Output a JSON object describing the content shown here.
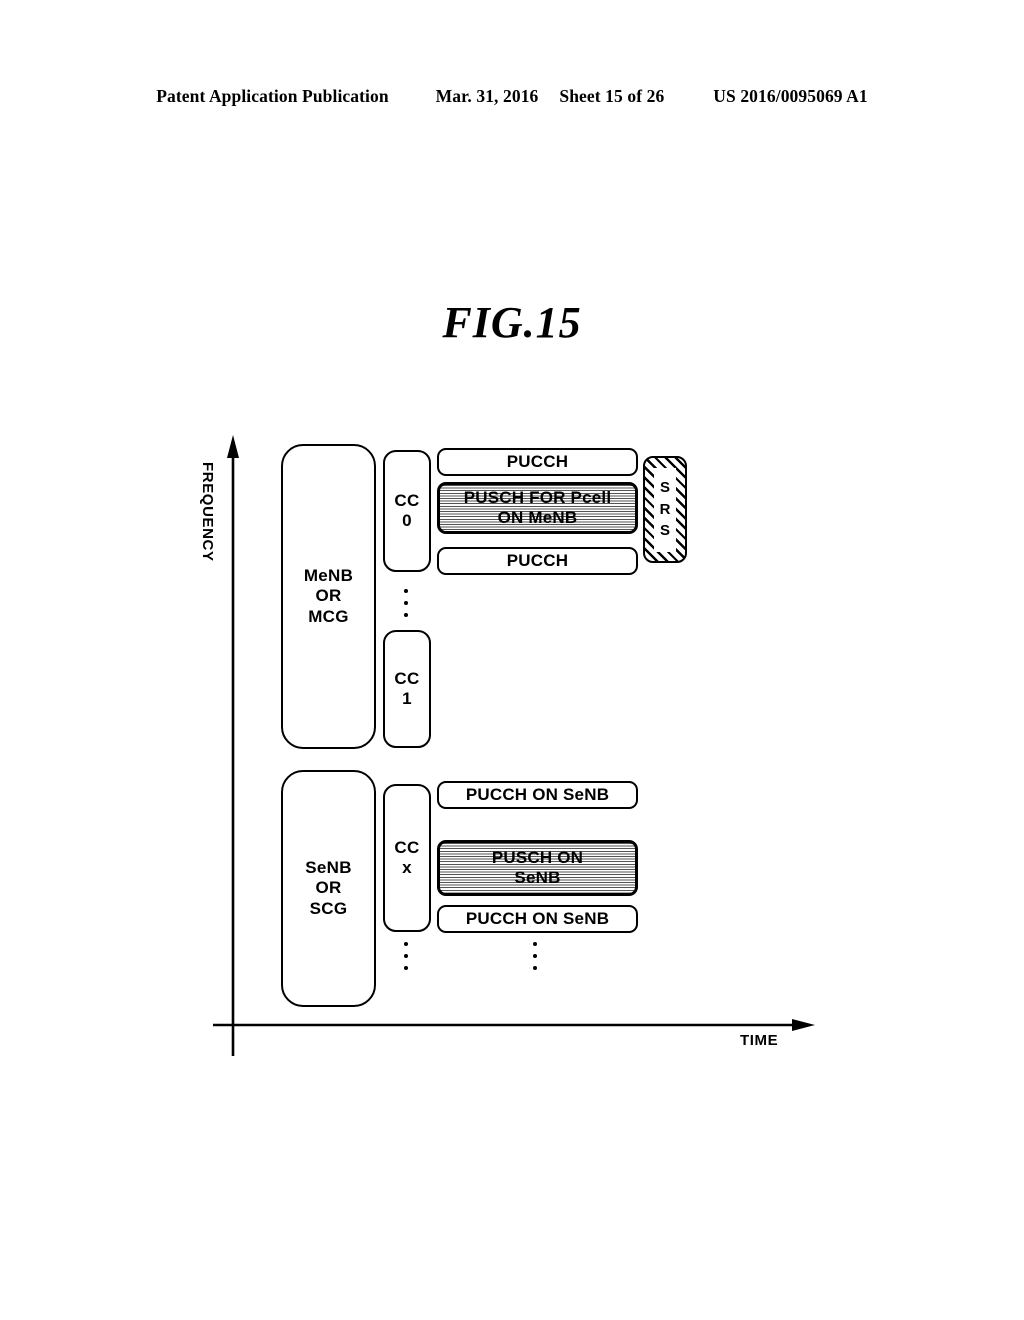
{
  "header": {
    "publication": "Patent Application Publication",
    "date": "Mar. 31, 2016",
    "sheet": "Sheet 15 of 26",
    "doc_number": "US 2016/0095069 A1"
  },
  "figure": {
    "title": "FIG.15"
  },
  "axes": {
    "y_label": "FREQUENCY",
    "x_label": "TIME"
  },
  "groups": [
    {
      "id": "menb",
      "label": "MeNB\nOR\nMCG",
      "carriers": [
        {
          "id": "cc0",
          "label": "CC\n0"
        },
        {
          "id": "cc1",
          "label": "CC\n1"
        }
      ]
    },
    {
      "id": "senb",
      "label": "SeNB\nOR\nSCG",
      "carriers": [
        {
          "id": "ccx",
          "label": "CC\nx"
        }
      ]
    }
  ],
  "channels": {
    "menb_cc0": [
      {
        "id": "pucch-top",
        "label": "PUCCH",
        "shaded": false
      },
      {
        "id": "pusch-pcell",
        "label": "PUSCH FOR Pcell\nON MeNB",
        "shaded": true
      },
      {
        "id": "pucch-bottom",
        "label": "PUCCH",
        "shaded": false
      }
    ],
    "senb_ccx": [
      {
        "id": "pucch-senb-top",
        "label": "PUCCH ON SeNB",
        "shaded": false
      },
      {
        "id": "pusch-senb",
        "label": "PUSCH ON\nSeNB",
        "shaded": true
      },
      {
        "id": "pucch-senb-bottom",
        "label": "PUCCH ON SeNB",
        "shaded": false
      }
    ]
  },
  "srs": {
    "label": "SRS",
    "letters": [
      "S",
      "R",
      "S"
    ]
  },
  "colors": {
    "line": "#000000",
    "background": "#ffffff",
    "shade_fill": "#c9c9c9"
  }
}
